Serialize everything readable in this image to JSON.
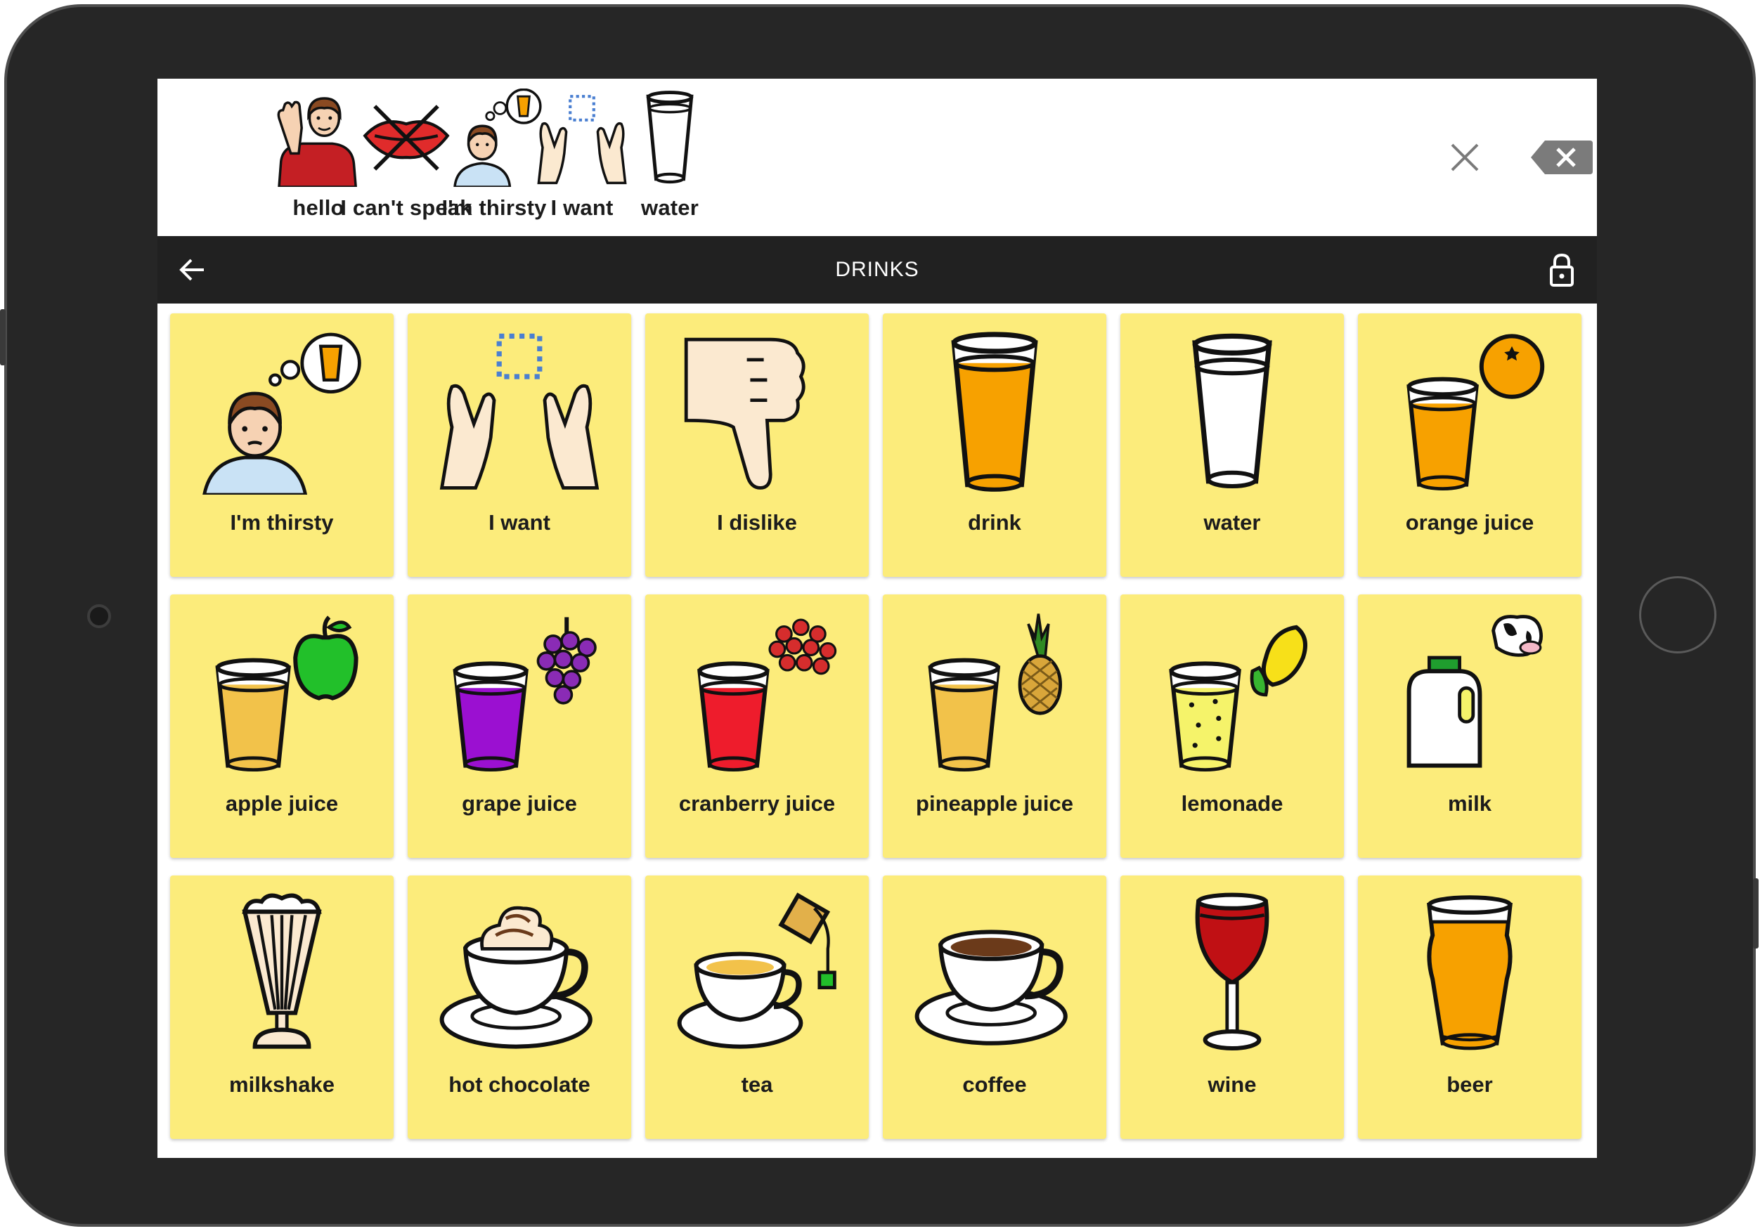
{
  "sentence": {
    "items": [
      {
        "label": "hello",
        "icon": "hello-icon"
      },
      {
        "label": "I can't speak",
        "icon": "cant-speak-icon"
      },
      {
        "label": "I'm thirsty",
        "icon": "thirsty-icon"
      },
      {
        "label": "I want",
        "icon": "want-icon"
      },
      {
        "label": "water",
        "icon": "water-glass-icon"
      }
    ],
    "clear_icon": "close-icon",
    "backspace_icon": "backspace-icon"
  },
  "header": {
    "title": "DRINKS",
    "back_icon": "arrow-left-icon",
    "lock_icon": "lock-icon",
    "background": "#212121"
  },
  "grid": {
    "tile_color": "#fcec7b",
    "tiles": [
      {
        "label": "I'm thirsty",
        "icon": "thirsty-icon"
      },
      {
        "label": "I want",
        "icon": "want-icon"
      },
      {
        "label": "I dislike",
        "icon": "thumbs-down-icon"
      },
      {
        "label": "drink",
        "icon": "drink-icon"
      },
      {
        "label": "water",
        "icon": "water-glass-icon"
      },
      {
        "label": "orange juice",
        "icon": "orange-juice-icon"
      },
      {
        "label": "apple juice",
        "icon": "apple-juice-icon"
      },
      {
        "label": "grape juice",
        "icon": "grape-juice-icon"
      },
      {
        "label": "cranberry juice",
        "icon": "cranberry-juice-icon"
      },
      {
        "label": "pineapple juice",
        "icon": "pineapple-juice-icon"
      },
      {
        "label": "lemonade",
        "icon": "lemonade-icon"
      },
      {
        "label": "milk",
        "icon": "milk-icon"
      },
      {
        "label": "milkshake",
        "icon": "milkshake-icon"
      },
      {
        "label": "hot chocolate",
        "icon": "hot-chocolate-icon"
      },
      {
        "label": "tea",
        "icon": "tea-icon"
      },
      {
        "label": "coffee",
        "icon": "coffee-icon"
      },
      {
        "label": "wine",
        "icon": "wine-icon"
      },
      {
        "label": "beer",
        "icon": "beer-icon"
      }
    ]
  }
}
